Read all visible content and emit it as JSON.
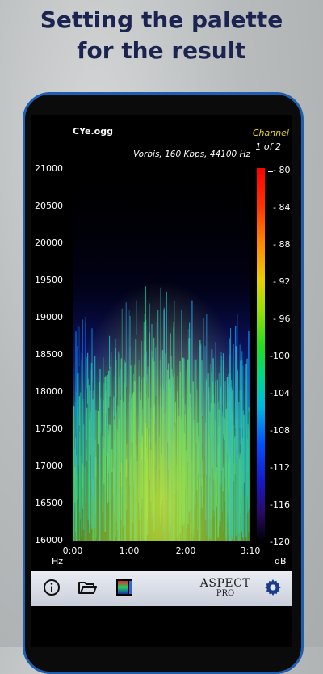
{
  "headline": {
    "line1": "Setting the palette",
    "line2": "for the result"
  },
  "app": {
    "file_name": "CYe.ogg",
    "codec_info": "Vorbis, 160 Kbps, 44100 Hz",
    "channel_label": "Channel",
    "channel_value": "1 of 2"
  },
  "axes": {
    "y_unit": "Hz",
    "y_ticks": [
      "21000",
      "20500",
      "20000",
      "19500",
      "19000",
      "18500",
      "18000",
      "17500",
      "17000",
      "16500",
      "16000"
    ],
    "x_ticks": [
      "0:00",
      "1:00",
      "2:00",
      "3:10"
    ],
    "db_unit": "dB",
    "db_ticks": [
      "- 80",
      "- 84",
      "- 88",
      "- 92",
      "- 96",
      "-100",
      "-104",
      "-108",
      "-112",
      "-116",
      "-120"
    ]
  },
  "toolbar": {
    "info_icon": "info-icon",
    "folder_icon": "folder-open-icon",
    "palette_icon": "palette-icon",
    "brand_main": "ASPECT",
    "brand_sub": "PRO",
    "settings_icon": "gear-icon"
  },
  "colors": {
    "headline": "#1b2350",
    "channel_label": "#e8d31f",
    "phone_frame": "#1d5fb0"
  }
}
